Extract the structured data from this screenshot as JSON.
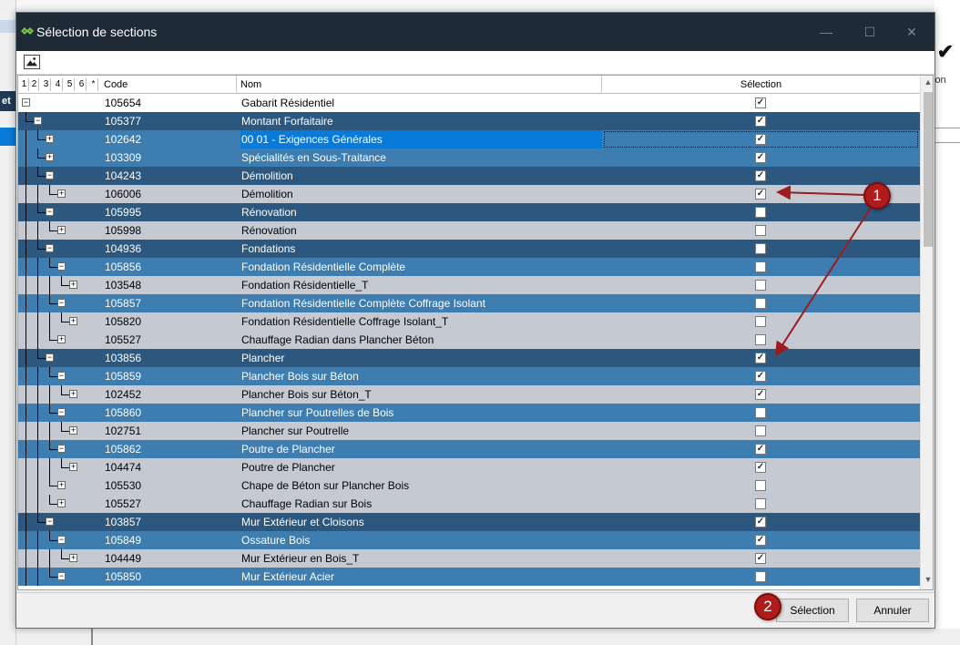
{
  "window": {
    "title": "Sélection de sections",
    "minimize": "—",
    "maximize": "☐",
    "close": "✕"
  },
  "background": {
    "left_label": "et",
    "right_label": "ion"
  },
  "grid": {
    "levels": [
      "1",
      "2",
      "3",
      "4",
      "5",
      "6",
      "*"
    ],
    "columns": {
      "code": "Code",
      "nom": "Nom",
      "selection": "Sélection"
    },
    "rows": [
      {
        "code": "105654",
        "nom": "Gabarit Résidentiel",
        "checked": true
      },
      {
        "code": "105377",
        "nom": "Montant Forfaitaire",
        "checked": true
      },
      {
        "code": "102642",
        "nom": "00 01 - Exigences Générales",
        "checked": true
      },
      {
        "code": "103309",
        "nom": "Spécialités en Sous-Traitance",
        "checked": true
      },
      {
        "code": "104243",
        "nom": "Démolition",
        "checked": true
      },
      {
        "code": "106006",
        "nom": "Démolition",
        "checked": true
      },
      {
        "code": "105995",
        "nom": "Rénovation",
        "checked": false
      },
      {
        "code": "105998",
        "nom": "Rénovation",
        "checked": false
      },
      {
        "code": "104936",
        "nom": "Fondations",
        "checked": false
      },
      {
        "code": "105856",
        "nom": "Fondation Résidentielle Complète",
        "checked": false
      },
      {
        "code": "103548",
        "nom": "Fondation Résidentielle_T",
        "checked": false
      },
      {
        "code": "105857",
        "nom": "Fondation Résidentielle Complète Coffrage Isolant",
        "checked": false
      },
      {
        "code": "105820",
        "nom": "Fondation Résidentielle Coffrage Isolant_T",
        "checked": false
      },
      {
        "code": "105527",
        "nom": "Chauffage Radian dans Plancher Béton",
        "checked": false
      },
      {
        "code": "103856",
        "nom": "Plancher",
        "checked": true
      },
      {
        "code": "105859",
        "nom": "Plancher Bois sur Béton",
        "checked": true
      },
      {
        "code": "102452",
        "nom": "Plancher Bois sur Béton_T",
        "checked": true
      },
      {
        "code": "105860",
        "nom": "Plancher sur Poutrelles de Bois",
        "checked": false
      },
      {
        "code": "102751",
        "nom": "Plancher sur Poutrelle",
        "checked": false
      },
      {
        "code": "105862",
        "nom": "Poutre de Plancher",
        "checked": true
      },
      {
        "code": "104474",
        "nom": "Poutre de Plancher",
        "checked": true
      },
      {
        "code": "105530",
        "nom": "Chape de Béton sur Plancher Bois",
        "checked": false
      },
      {
        "code": "105527",
        "nom": "Chauffage Radian sur Bois",
        "checked": false
      },
      {
        "code": "103857",
        "nom": "Mur Extérieur et Cloisons",
        "checked": true
      },
      {
        "code": "105849",
        "nom": "Ossature Bois",
        "checked": true
      },
      {
        "code": "104449",
        "nom": "Mur Extérieur en Bois_T",
        "checked": true
      },
      {
        "code": "105850",
        "nom": "Mur Extérieur Acier",
        "checked": false
      }
    ]
  },
  "footer": {
    "select_label": "Sélection",
    "cancel_label": "Annuler"
  },
  "annotations": {
    "badge1": "1",
    "badge2": "2"
  },
  "colors": {
    "titlebar": "#1f2a37",
    "row_dark": "#2c5880",
    "row_mid": "#3e7db0",
    "row_light": "#c5cad2",
    "row_active": "#0a7ad8",
    "annotation": "#b01b1b"
  },
  "icons": {
    "app": "app-logo-icon",
    "toolbar": "image-icon",
    "expand": "plus-box-icon",
    "collapse": "minus-box-icon"
  }
}
